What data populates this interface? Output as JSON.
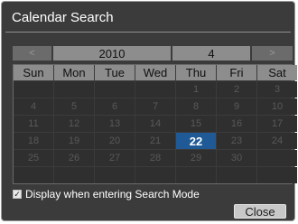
{
  "dialog": {
    "title": "Calendar Search",
    "nav": {
      "prev_label": "<",
      "year": "2010",
      "month": "4",
      "next_label": ">"
    },
    "weekdays": [
      "Sun",
      "Mon",
      "Tue",
      "Wed",
      "Thu",
      "Fri",
      "Sat"
    ],
    "weeks": [
      [
        "",
        "",
        "",
        "",
        "1",
        "2",
        "3"
      ],
      [
        "4",
        "5",
        "6",
        "7",
        "8",
        "9",
        "10"
      ],
      [
        "11",
        "12",
        "13",
        "14",
        "15",
        "16",
        "17"
      ],
      [
        "18",
        "19",
        "20",
        "21",
        "22",
        "23",
        "24"
      ],
      [
        "25",
        "26",
        "27",
        "28",
        "29",
        "30",
        ""
      ],
      [
        "",
        "",
        "",
        "",
        "",
        "",
        ""
      ]
    ],
    "selected_day": "22",
    "display_option": {
      "checked": true,
      "label": "Display when entering Search Mode"
    },
    "close_label": "Close"
  },
  "colors": {
    "dialog_bg": "#3b3b3b",
    "header_bg": "#8d8d8d",
    "selected_bg": "#1f5a96",
    "cell_bg": "#2f2f2f"
  }
}
